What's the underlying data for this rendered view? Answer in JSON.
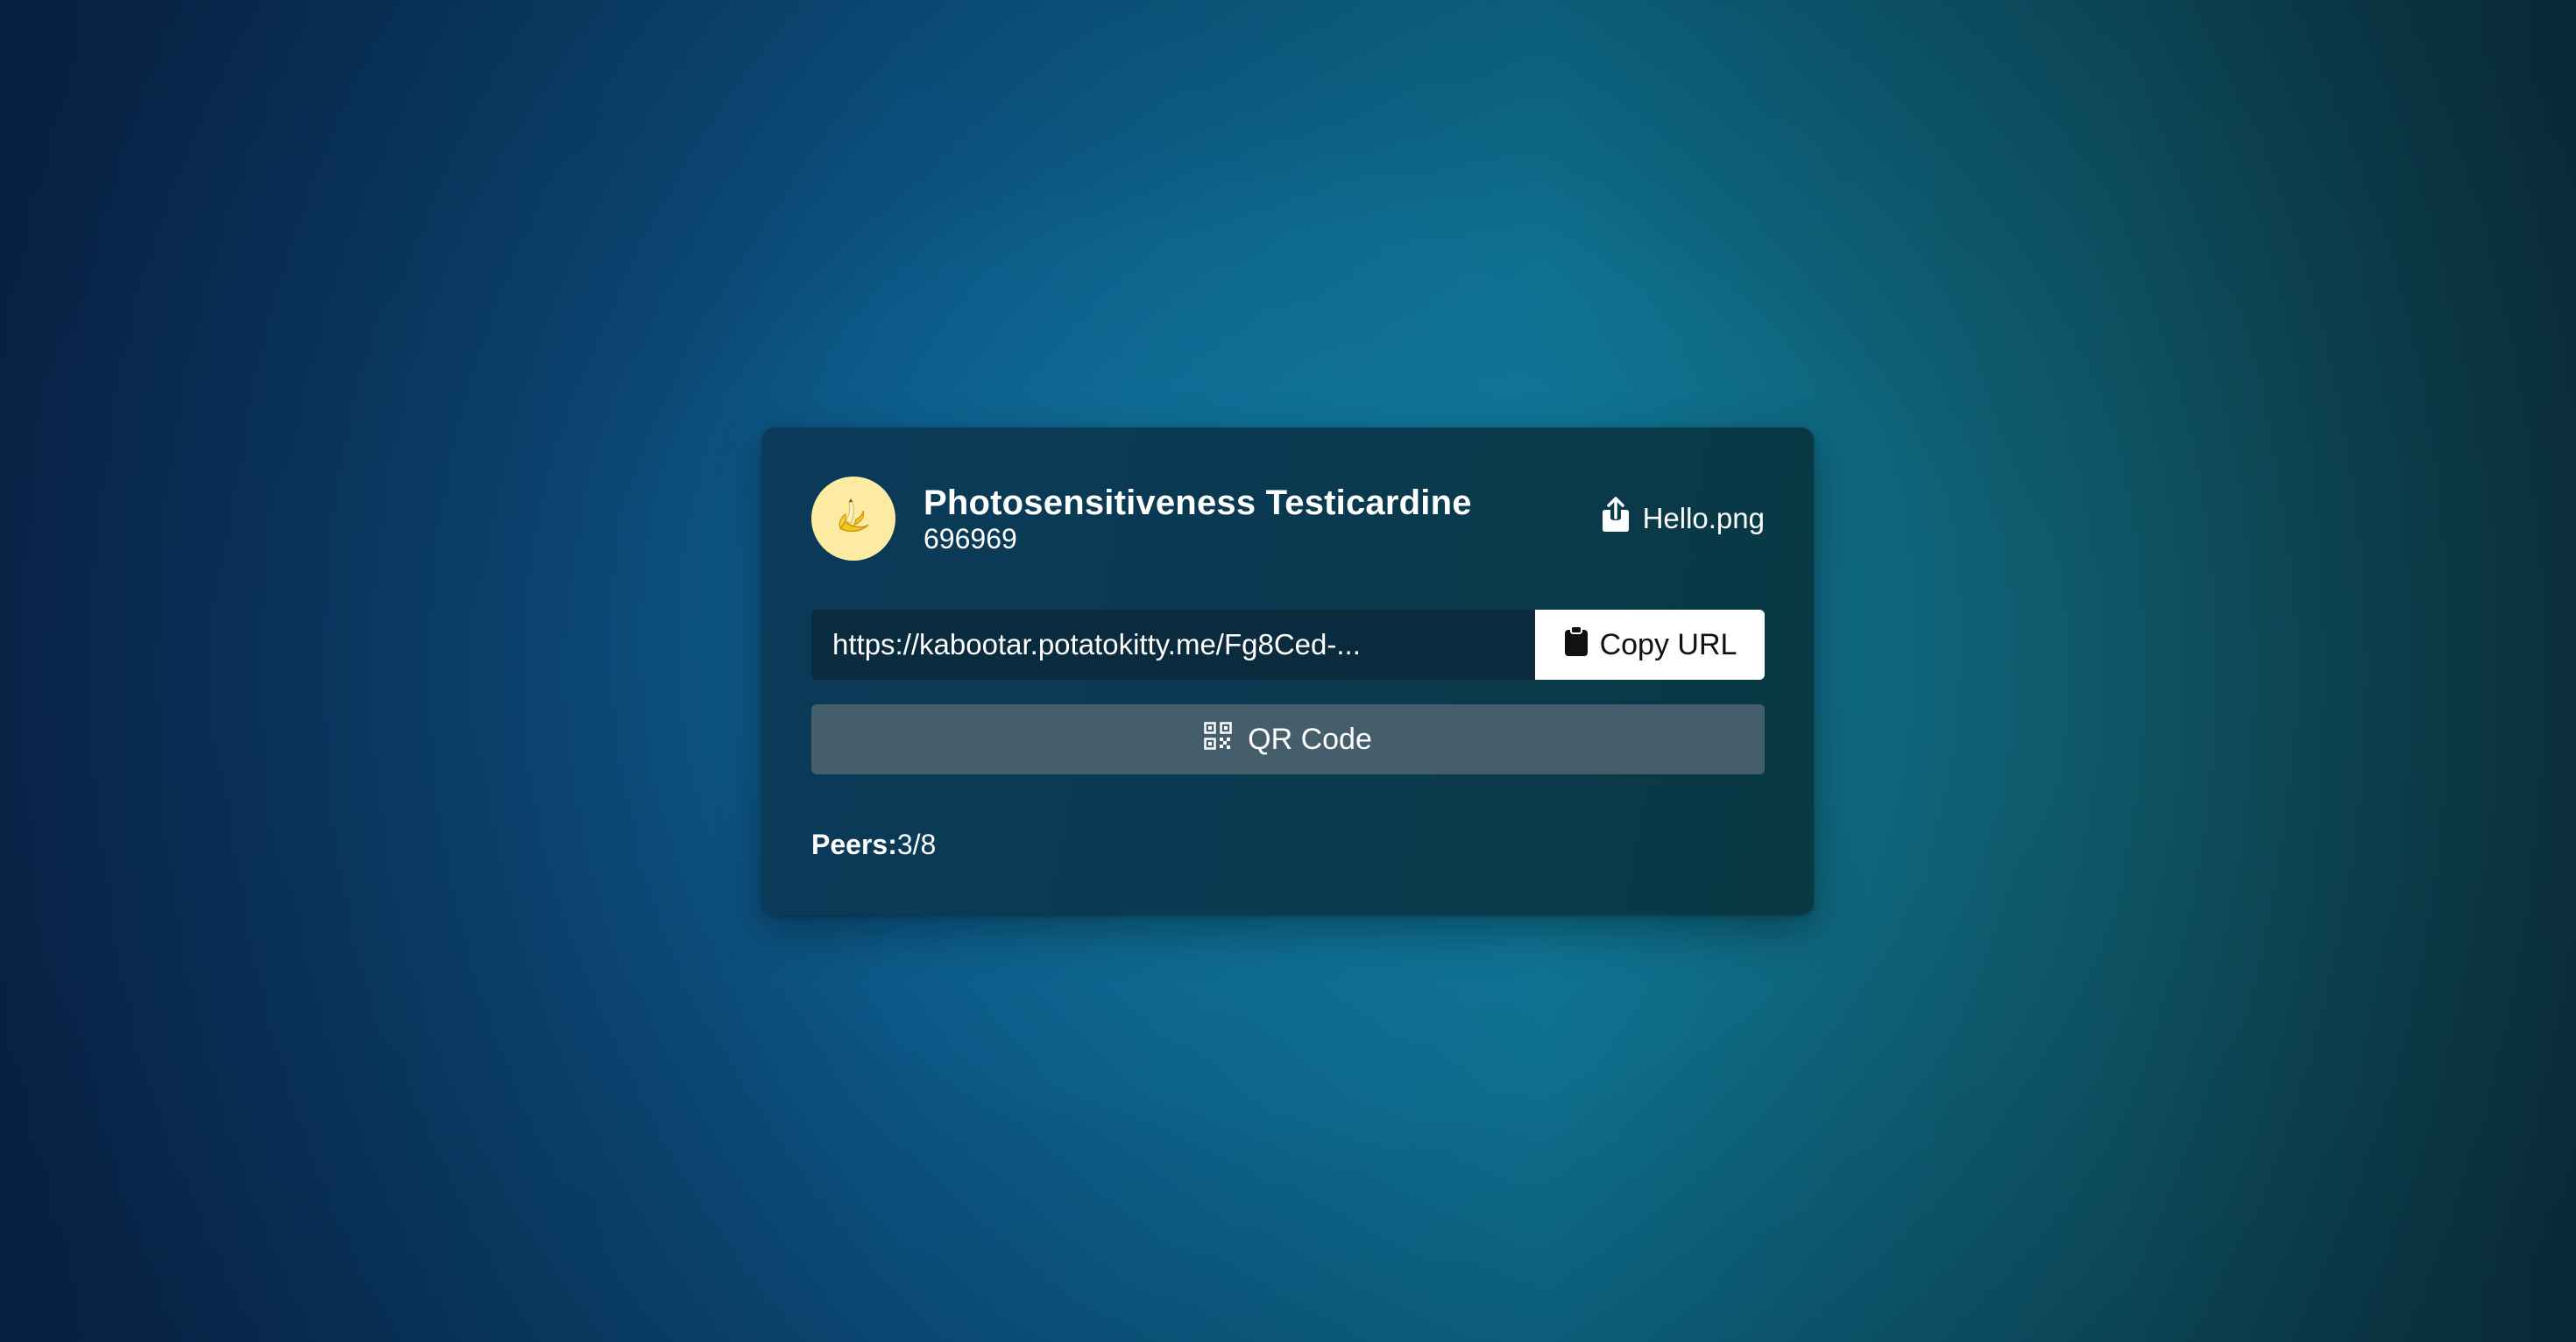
{
  "room": {
    "user": {
      "name": "Photosensitiveness Testicardine",
      "id": "696969",
      "avatar_icon": "banana-icon",
      "avatar_bg": "#fdeba4"
    },
    "file": {
      "icon": "share-icon",
      "name": "Hello.png"
    },
    "share": {
      "url": "https://kabootar.potatokitty.me/Fg8Ced-...",
      "copy_icon": "clipboard-icon",
      "copy_label": "Copy URL"
    },
    "qr": {
      "icon": "qr-code-icon",
      "label": "QR Code"
    },
    "peers": {
      "label": "Peers:",
      "value": "3/8"
    }
  },
  "colors": {
    "card_bg": "#0a3a50",
    "copy_button_bg": "#ffffff",
    "qr_button_bg": "#455e6c"
  }
}
